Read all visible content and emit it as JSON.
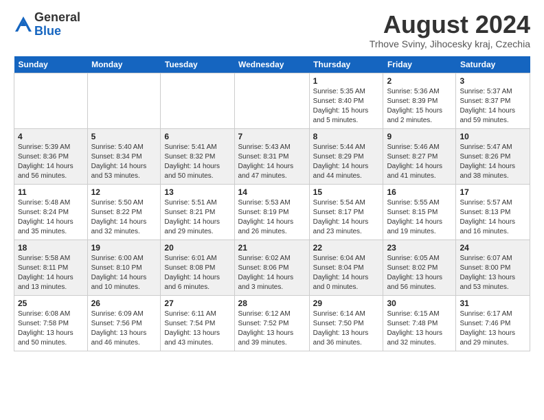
{
  "logo": {
    "general": "General",
    "blue": "Blue"
  },
  "header": {
    "month": "August 2024",
    "location": "Trhove Sviny, Jihocesky kraj, Czechia"
  },
  "weekdays": [
    "Sunday",
    "Monday",
    "Tuesday",
    "Wednesday",
    "Thursday",
    "Friday",
    "Saturday"
  ],
  "weeks": [
    [
      {
        "day": "",
        "info": ""
      },
      {
        "day": "",
        "info": ""
      },
      {
        "day": "",
        "info": ""
      },
      {
        "day": "",
        "info": ""
      },
      {
        "day": "1",
        "info": "Sunrise: 5:35 AM\nSunset: 8:40 PM\nDaylight: 15 hours\nand 5 minutes."
      },
      {
        "day": "2",
        "info": "Sunrise: 5:36 AM\nSunset: 8:39 PM\nDaylight: 15 hours\nand 2 minutes."
      },
      {
        "day": "3",
        "info": "Sunrise: 5:37 AM\nSunset: 8:37 PM\nDaylight: 14 hours\nand 59 minutes."
      }
    ],
    [
      {
        "day": "4",
        "info": "Sunrise: 5:39 AM\nSunset: 8:36 PM\nDaylight: 14 hours\nand 56 minutes."
      },
      {
        "day": "5",
        "info": "Sunrise: 5:40 AM\nSunset: 8:34 PM\nDaylight: 14 hours\nand 53 minutes."
      },
      {
        "day": "6",
        "info": "Sunrise: 5:41 AM\nSunset: 8:32 PM\nDaylight: 14 hours\nand 50 minutes."
      },
      {
        "day": "7",
        "info": "Sunrise: 5:43 AM\nSunset: 8:31 PM\nDaylight: 14 hours\nand 47 minutes."
      },
      {
        "day": "8",
        "info": "Sunrise: 5:44 AM\nSunset: 8:29 PM\nDaylight: 14 hours\nand 44 minutes."
      },
      {
        "day": "9",
        "info": "Sunrise: 5:46 AM\nSunset: 8:27 PM\nDaylight: 14 hours\nand 41 minutes."
      },
      {
        "day": "10",
        "info": "Sunrise: 5:47 AM\nSunset: 8:26 PM\nDaylight: 14 hours\nand 38 minutes."
      }
    ],
    [
      {
        "day": "11",
        "info": "Sunrise: 5:48 AM\nSunset: 8:24 PM\nDaylight: 14 hours\nand 35 minutes."
      },
      {
        "day": "12",
        "info": "Sunrise: 5:50 AM\nSunset: 8:22 PM\nDaylight: 14 hours\nand 32 minutes."
      },
      {
        "day": "13",
        "info": "Sunrise: 5:51 AM\nSunset: 8:21 PM\nDaylight: 14 hours\nand 29 minutes."
      },
      {
        "day": "14",
        "info": "Sunrise: 5:53 AM\nSunset: 8:19 PM\nDaylight: 14 hours\nand 26 minutes."
      },
      {
        "day": "15",
        "info": "Sunrise: 5:54 AM\nSunset: 8:17 PM\nDaylight: 14 hours\nand 23 minutes."
      },
      {
        "day": "16",
        "info": "Sunrise: 5:55 AM\nSunset: 8:15 PM\nDaylight: 14 hours\nand 19 minutes."
      },
      {
        "day": "17",
        "info": "Sunrise: 5:57 AM\nSunset: 8:13 PM\nDaylight: 14 hours\nand 16 minutes."
      }
    ],
    [
      {
        "day": "18",
        "info": "Sunrise: 5:58 AM\nSunset: 8:11 PM\nDaylight: 14 hours\nand 13 minutes."
      },
      {
        "day": "19",
        "info": "Sunrise: 6:00 AM\nSunset: 8:10 PM\nDaylight: 14 hours\nand 10 minutes."
      },
      {
        "day": "20",
        "info": "Sunrise: 6:01 AM\nSunset: 8:08 PM\nDaylight: 14 hours\nand 6 minutes."
      },
      {
        "day": "21",
        "info": "Sunrise: 6:02 AM\nSunset: 8:06 PM\nDaylight: 14 hours\nand 3 minutes."
      },
      {
        "day": "22",
        "info": "Sunrise: 6:04 AM\nSunset: 8:04 PM\nDaylight: 14 hours\nand 0 minutes."
      },
      {
        "day": "23",
        "info": "Sunrise: 6:05 AM\nSunset: 8:02 PM\nDaylight: 13 hours\nand 56 minutes."
      },
      {
        "day": "24",
        "info": "Sunrise: 6:07 AM\nSunset: 8:00 PM\nDaylight: 13 hours\nand 53 minutes."
      }
    ],
    [
      {
        "day": "25",
        "info": "Sunrise: 6:08 AM\nSunset: 7:58 PM\nDaylight: 13 hours\nand 50 minutes."
      },
      {
        "day": "26",
        "info": "Sunrise: 6:09 AM\nSunset: 7:56 PM\nDaylight: 13 hours\nand 46 minutes."
      },
      {
        "day": "27",
        "info": "Sunrise: 6:11 AM\nSunset: 7:54 PM\nDaylight: 13 hours\nand 43 minutes."
      },
      {
        "day": "28",
        "info": "Sunrise: 6:12 AM\nSunset: 7:52 PM\nDaylight: 13 hours\nand 39 minutes."
      },
      {
        "day": "29",
        "info": "Sunrise: 6:14 AM\nSunset: 7:50 PM\nDaylight: 13 hours\nand 36 minutes."
      },
      {
        "day": "30",
        "info": "Sunrise: 6:15 AM\nSunset: 7:48 PM\nDaylight: 13 hours\nand 32 minutes."
      },
      {
        "day": "31",
        "info": "Sunrise: 6:17 AM\nSunset: 7:46 PM\nDaylight: 13 hours\nand 29 minutes."
      }
    ]
  ]
}
